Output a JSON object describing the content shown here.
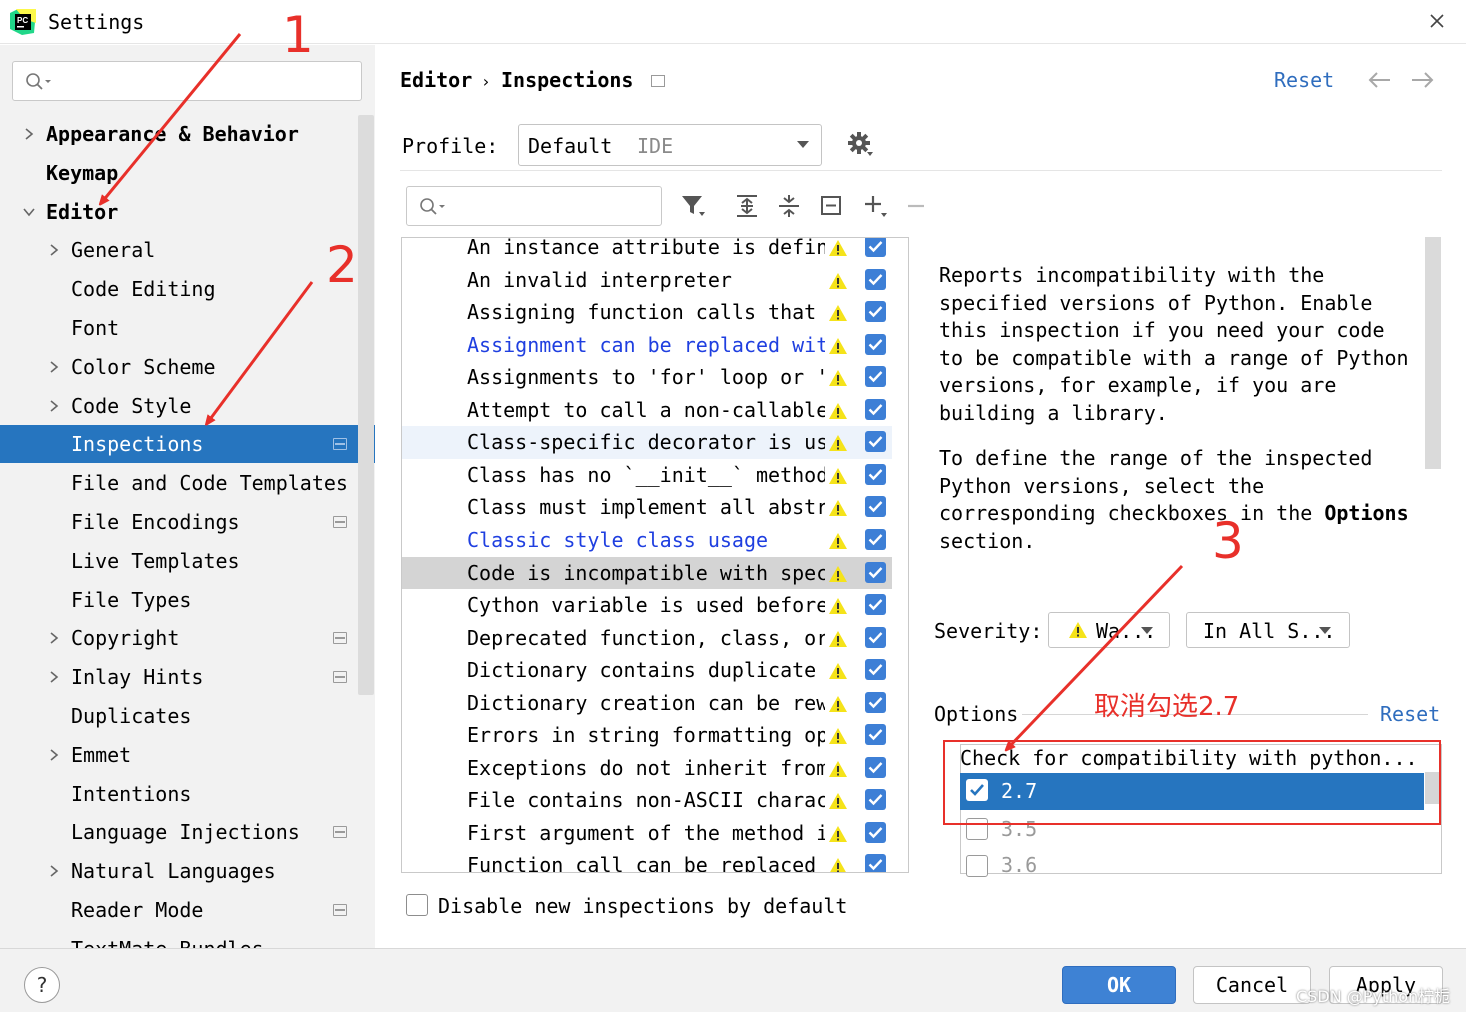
{
  "window": {
    "title": "Settings",
    "close_icon": "close-icon"
  },
  "sidebar": {
    "search_placeholder": "",
    "items": [
      {
        "label": "Appearance & Behavior",
        "level": 0,
        "expandable": true,
        "expanded": false,
        "bold": true
      },
      {
        "label": "Keymap",
        "level": 0,
        "expandable": false,
        "bold": true
      },
      {
        "label": "Editor",
        "level": 0,
        "expandable": true,
        "expanded": true,
        "bold": true
      },
      {
        "label": "General",
        "level": 1,
        "expandable": true
      },
      {
        "label": "Code Editing",
        "level": 1,
        "expandable": false
      },
      {
        "label": "Font",
        "level": 1,
        "expandable": false
      },
      {
        "label": "Color Scheme",
        "level": 1,
        "expandable": true
      },
      {
        "label": "Code Style",
        "level": 1,
        "expandable": true
      },
      {
        "label": "Inspections",
        "level": 1,
        "expandable": false,
        "selected": true,
        "project_icon": true
      },
      {
        "label": "File and Code Templates",
        "level": 1,
        "expandable": false
      },
      {
        "label": "File Encodings",
        "level": 1,
        "expandable": false,
        "project_icon": true
      },
      {
        "label": "Live Templates",
        "level": 1,
        "expandable": false
      },
      {
        "label": "File Types",
        "level": 1,
        "expandable": false
      },
      {
        "label": "Copyright",
        "level": 1,
        "expandable": true,
        "project_icon": true
      },
      {
        "label": "Inlay Hints",
        "level": 1,
        "expandable": true,
        "project_icon": true
      },
      {
        "label": "Duplicates",
        "level": 1,
        "expandable": false
      },
      {
        "label": "Emmet",
        "level": 1,
        "expandable": true
      },
      {
        "label": "Intentions",
        "level": 1,
        "expandable": false
      },
      {
        "label": "Language Injections",
        "level": 1,
        "expandable": false,
        "project_icon": true
      },
      {
        "label": "Natural Languages",
        "level": 1,
        "expandable": true
      },
      {
        "label": "Reader Mode",
        "level": 1,
        "expandable": false,
        "project_icon": true
      },
      {
        "label": "TextMate Bundles",
        "level": 1,
        "expandable": false
      }
    ]
  },
  "header": {
    "breadcrumb_1": "Editor",
    "breadcrumb_sep": "›",
    "breadcrumb_2": "Inspections",
    "reset_label": "Reset"
  },
  "profile": {
    "label": "Profile:",
    "value": "Default",
    "scope": "IDE"
  },
  "inspections": {
    "search_placeholder": "",
    "rows": [
      {
        "text": "An instance attribute is defin",
        "link": false,
        "checked": true
      },
      {
        "text": "An invalid interpreter",
        "link": false,
        "checked": true
      },
      {
        "text": "Assigning function calls that",
        "link": false,
        "checked": true
      },
      {
        "text": "Assignment can be replaced with",
        "link": true,
        "checked": true
      },
      {
        "text": "Assignments to 'for' loop or '",
        "link": false,
        "checked": true
      },
      {
        "text": "Attempt to call a non-callable",
        "link": false,
        "checked": true
      },
      {
        "text": "Class-specific decorator is us",
        "link": false,
        "checked": true,
        "hover": true
      },
      {
        "text": "Class has no `__init__` method",
        "link": false,
        "checked": true
      },
      {
        "text": "Class must implement all abstr",
        "link": false,
        "checked": true
      },
      {
        "text": "Classic style class usage",
        "link": true,
        "checked": true
      },
      {
        "text": "Code is incompatible with spec",
        "link": false,
        "checked": true,
        "selected": true
      },
      {
        "text": "Cython variable is used before",
        "link": false,
        "checked": true
      },
      {
        "text": "Deprecated function, class, or",
        "link": false,
        "checked": true
      },
      {
        "text": "Dictionary contains duplicate",
        "link": false,
        "checked": true
      },
      {
        "text": "Dictionary creation can be rew",
        "link": false,
        "checked": true
      },
      {
        "text": "Errors in string formatting op",
        "link": false,
        "checked": true
      },
      {
        "text": "Exceptions do not inherit from",
        "link": false,
        "checked": true
      },
      {
        "text": "File contains non-ASCII charac",
        "link": false,
        "checked": true
      },
      {
        "text": "First argument of the method i",
        "link": false,
        "checked": true
      },
      {
        "text": "Function call can be replaced",
        "link": false,
        "checked": true
      }
    ],
    "disable_new_label": "Disable new inspections by default"
  },
  "description": {
    "para1": "Reports incompatibility with the specified versions of Python. Enable this inspection if you need your code to be compatible with a range of Python versions, for example, if you are building a library.",
    "para2_a": "To define the range of the inspected Python versions, select the corresponding checkboxes in the",
    "para2_bold": "Options",
    "para2_b": "section."
  },
  "severity": {
    "label": "Severity:",
    "value": "Wa...",
    "scope": "In All S..."
  },
  "options": {
    "label": "Options",
    "reset_label": "Reset",
    "header": "Check for compatibility with python...",
    "versions": [
      {
        "label": "2.7",
        "checked": true,
        "selected": true
      },
      {
        "label": "3.5",
        "checked": false
      },
      {
        "label": "3.6",
        "checked": false
      }
    ]
  },
  "buttons": {
    "help": "?",
    "ok": "OK",
    "cancel": "Cancel",
    "apply": "Apply"
  },
  "annotations": {
    "num1": "1",
    "num2": "2",
    "num3": "3",
    "note": "取消勾选2.7",
    "color": "#e8302a"
  },
  "watermark": "CSDN @Python柠栀",
  "colors": {
    "accent": "#2675bf",
    "link": "#2f6dbe",
    "checkbox": "#3d7fd6",
    "warning": "#f5e31a"
  }
}
